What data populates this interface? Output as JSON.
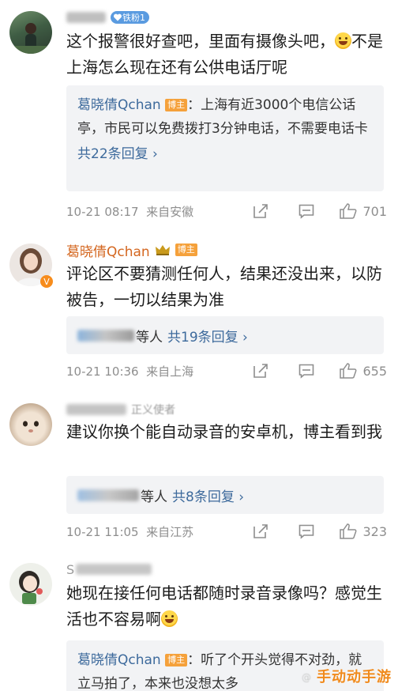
{
  "comments": [
    {
      "fan_badge": "铁粉1",
      "text": "这个报警很好查吧，里面有摄像头吧，",
      "text_after_emoji": "不是 上海怎么现在还有公供电话厅呢",
      "reply": {
        "author": "葛晓倩Qchan",
        "tag": "博主",
        "text": "：上海有近3000个电信公话亭，市民可以免费拨打3分钟电话，不需要电话卡",
        "more": "共22条回复"
      },
      "time": "10-21 08:17",
      "location": "来自安徽",
      "likes": "701"
    },
    {
      "author": "葛晓倩Qchan",
      "tag": "博主",
      "text": "评论区不要猜测任何人，结果还没出来，以防被告，一切以结果为准",
      "reply_suffix": "等人",
      "reply_more": "共19条回复",
      "time": "10-21 10:36",
      "location": "来自上海",
      "likes": "655"
    },
    {
      "badge_text": "正义使者",
      "text": "建议你换个能自动录音的安卓机，博主看到我",
      "reply_suffix": "等人",
      "reply_more": "共8条回复",
      "time": "10-21 11:05",
      "location": "来自江苏",
      "likes": "323"
    },
    {
      "author_initial": "S",
      "text": "她现在接任何电话都随时录音录像吗？感觉生活也不容易啊",
      "reply": {
        "author": "葛晓倩Qchan",
        "tag": "博主",
        "text": "：听了个开头觉得不对劲，就立马拍了，本来也没想太多"
      }
    }
  ],
  "watermark": "手动动手游",
  "icons": [
    "share-icon",
    "comment-icon",
    "like-icon",
    "fan-heart-icon",
    "crown-icon",
    "verified-icon"
  ],
  "colors": {
    "link": "#3d6a9c",
    "author": "#d4661f",
    "blogger_tag": "#f5a13b",
    "meta": "#8e8e8e",
    "reply_bg": "#f2f3f5"
  }
}
